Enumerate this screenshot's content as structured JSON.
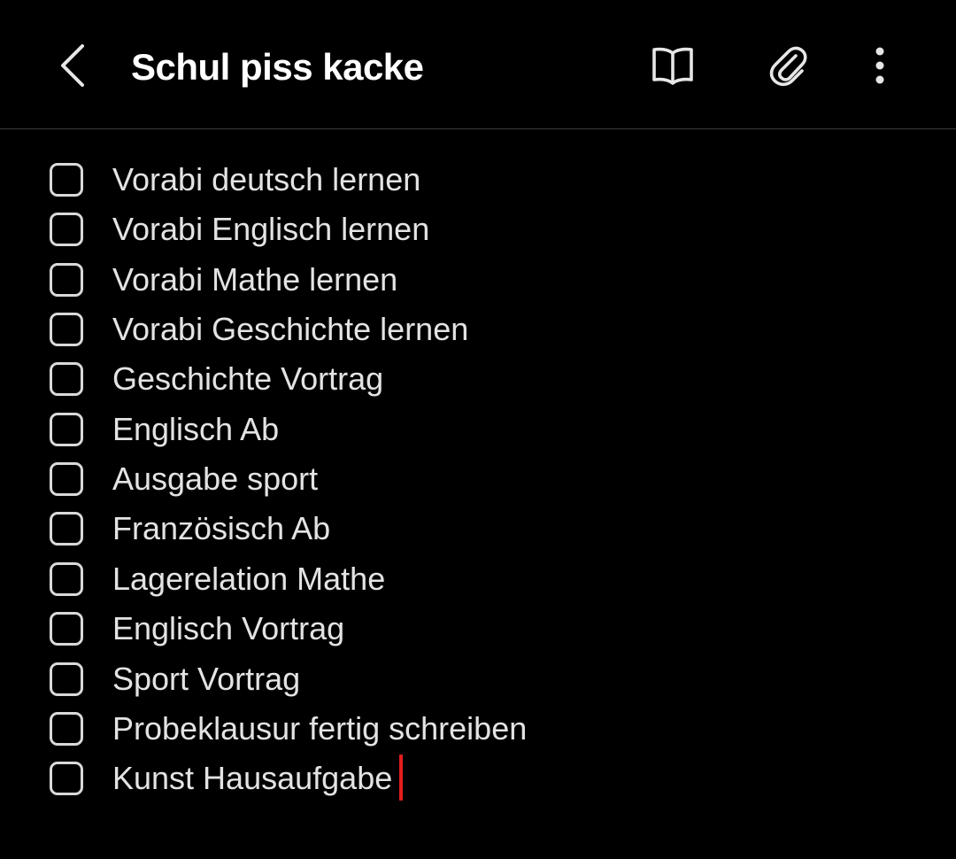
{
  "header": {
    "title": "Schul piss kacke",
    "back_icon": "chevron-left-icon",
    "actions": [
      {
        "name": "reading-mode",
        "icon": "book-open-icon"
      },
      {
        "name": "attach",
        "icon": "paperclip-icon"
      },
      {
        "name": "more",
        "icon": "more-vertical-icon"
      }
    ]
  },
  "colors": {
    "background": "#000000",
    "text": "#e3e3e3",
    "title": "#ffffff",
    "divider": "#3a3a3a",
    "cursor": "#e01d1d"
  },
  "checklist": {
    "items": [
      {
        "label": "Vorabi deutsch lernen",
        "checked": false
      },
      {
        "label": "Vorabi Englisch lernen",
        "checked": false
      },
      {
        "label": "Vorabi Mathe lernen",
        "checked": false
      },
      {
        "label": "Vorabi Geschichte lernen",
        "checked": false
      },
      {
        "label": "Geschichte Vortrag",
        "checked": false
      },
      {
        "label": "Englisch Ab",
        "checked": false
      },
      {
        "label": "Ausgabe sport",
        "checked": false
      },
      {
        "label": "Französisch Ab",
        "checked": false
      },
      {
        "label": "Lagerelation Mathe",
        "checked": false
      },
      {
        "label": "Englisch Vortrag",
        "checked": false
      },
      {
        "label": "Sport Vortrag",
        "checked": false
      },
      {
        "label": "Probeklausur fertig schreiben",
        "checked": false
      },
      {
        "label": "Kunst Hausaufgabe",
        "checked": false
      }
    ]
  }
}
